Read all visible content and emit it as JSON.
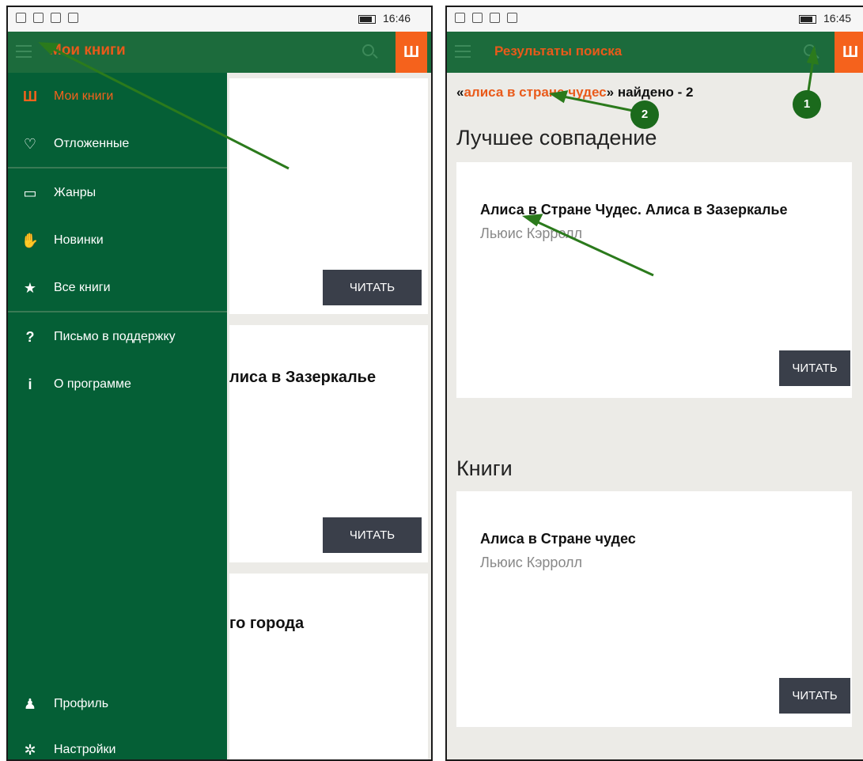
{
  "left": {
    "status_time": "16:46",
    "title": "Мои книги",
    "book_icon": "Ш",
    "drawer": [
      {
        "label": "Мои книги",
        "icon": "book-icon",
        "glyph": "Ш",
        "active": true
      },
      {
        "label": "Отложенные",
        "icon": "heart-icon",
        "glyph": "♡",
        "active": false
      },
      {
        "label": "Жанры",
        "icon": "tray-icon",
        "glyph": "▭",
        "active": false
      },
      {
        "label": "Новинки",
        "icon": "thumbs-up-icon",
        "glyph": "✋",
        "active": false
      },
      {
        "label": "Все книги",
        "icon": "star-icon",
        "glyph": "★",
        "active": false
      },
      {
        "label": "Письмо в поддержку",
        "icon": "question-icon",
        "glyph": "?",
        "active": false
      },
      {
        "label": "О программе",
        "icon": "info-icon",
        "glyph": "i",
        "active": false
      }
    ],
    "drawer_bottom": [
      {
        "label": "Профиль",
        "icon": "person-icon",
        "glyph": "♟"
      },
      {
        "label": "Настройки",
        "icon": "gear-icon",
        "glyph": "✲"
      }
    ],
    "cards": [
      {
        "title": "",
        "button": "ЧИТАТЬ"
      },
      {
        "title": "лиса в Зазеркалье",
        "button": "ЧИТАТЬ"
      },
      {
        "title": "го города"
      }
    ]
  },
  "right": {
    "status_time": "16:45",
    "title": "Результаты поиска",
    "book_icon": "Ш",
    "query_open": "«",
    "query": "алиса в стране чудес",
    "query_close": "» найдено - 2",
    "best_heading": "Лучшее совпадение",
    "best": {
      "title": "Алиса в Стране Чудес. Алиса в Зазеркалье",
      "author": "Льюис Кэрролл",
      "button": "ЧИТАТЬ"
    },
    "books_heading": "Книги",
    "books": [
      {
        "title": "Алиса в Стране чудес",
        "author": "Льюис Кэрролл",
        "button": "ЧИТАТЬ"
      }
    ]
  },
  "annotations": {
    "badge1": "1",
    "badge2": "2",
    "color": "#1b6a1c"
  },
  "colors": {
    "appbar": "#1c6b3c",
    "drawer": "#055f36",
    "accent": "#f5621c",
    "button": "#3a3f4a",
    "background": "#ecebe7"
  }
}
